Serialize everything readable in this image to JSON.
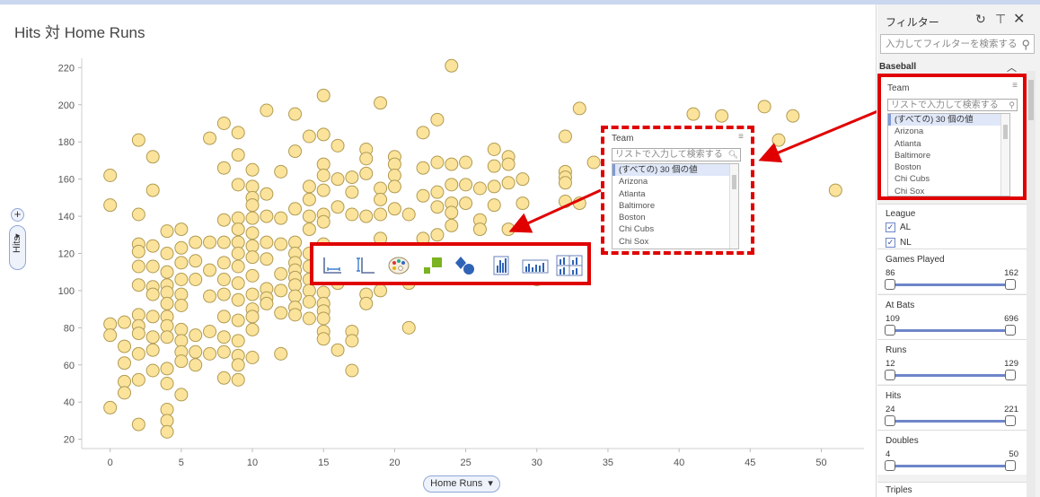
{
  "visualization": {
    "title": "Hits 対 Home Runs",
    "x_axis_button": "Home Runs",
    "y_axis_button": "Hits",
    "plus": "+"
  },
  "chart_data": {
    "type": "scatter",
    "title": "Hits 対 Home Runs",
    "xlabel": "Home Runs",
    "ylabel": "Hits",
    "xlim": [
      -2,
      53
    ],
    "ylim": [
      15,
      225
    ],
    "xticks": [
      "0",
      "5",
      "10",
      "15",
      "20",
      "25",
      "30",
      "35",
      "40",
      "45",
      "50"
    ],
    "yticks": [
      "20",
      "40",
      "60",
      "80",
      "100",
      "120",
      "140",
      "160",
      "180",
      "200",
      "220"
    ],
    "grid": false,
    "marker_color": "#fbe39b",
    "marker_edge": "#b19b52",
    "points": [
      [
        0,
        162
      ],
      [
        0,
        146
      ],
      [
        0,
        82
      ],
      [
        0,
        76
      ],
      [
        0,
        37
      ],
      [
        1,
        83
      ],
      [
        1,
        70
      ],
      [
        1,
        61
      ],
      [
        1,
        51
      ],
      [
        1,
        45
      ],
      [
        2,
        181
      ],
      [
        2,
        141
      ],
      [
        2,
        125
      ],
      [
        2,
        121
      ],
      [
        2,
        113
      ],
      [
        2,
        103
      ],
      [
        2,
        87
      ],
      [
        2,
        81
      ],
      [
        2,
        77
      ],
      [
        2,
        66
      ],
      [
        2,
        52
      ],
      [
        2,
        28
      ],
      [
        3,
        172
      ],
      [
        3,
        154
      ],
      [
        3,
        124
      ],
      [
        3,
        113
      ],
      [
        3,
        102
      ],
      [
        3,
        98
      ],
      [
        3,
        86
      ],
      [
        3,
        75
      ],
      [
        3,
        68
      ],
      [
        3,
        57
      ],
      [
        4,
        132
      ],
      [
        4,
        120
      ],
      [
        4,
        110
      ],
      [
        4,
        103
      ],
      [
        4,
        99
      ],
      [
        4,
        93
      ],
      [
        4,
        86
      ],
      [
        4,
        81
      ],
      [
        4,
        75
      ],
      [
        4,
        58
      ],
      [
        4,
        50
      ],
      [
        4,
        36
      ],
      [
        4,
        30
      ],
      [
        4,
        24
      ],
      [
        5,
        133
      ],
      [
        5,
        123
      ],
      [
        5,
        115
      ],
      [
        5,
        106
      ],
      [
        5,
        98
      ],
      [
        5,
        92
      ],
      [
        5,
        79
      ],
      [
        5,
        73
      ],
      [
        5,
        67
      ],
      [
        5,
        62
      ],
      [
        5,
        44
      ],
      [
        6,
        126
      ],
      [
        6,
        116
      ],
      [
        6,
        106
      ],
      [
        6,
        76
      ],
      [
        6,
        67
      ],
      [
        6,
        60
      ],
      [
        7,
        182
      ],
      [
        7,
        126
      ],
      [
        7,
        111
      ],
      [
        7,
        97
      ],
      [
        7,
        78
      ],
      [
        7,
        66
      ],
      [
        8,
        190
      ],
      [
        8,
        166
      ],
      [
        8,
        138
      ],
      [
        8,
        126
      ],
      [
        8,
        115
      ],
      [
        8,
        106
      ],
      [
        8,
        98
      ],
      [
        8,
        86
      ],
      [
        8,
        75
      ],
      [
        8,
        67
      ],
      [
        8,
        53
      ],
      [
        9,
        185
      ],
      [
        9,
        173
      ],
      [
        9,
        157
      ],
      [
        9,
        139
      ],
      [
        9,
        133
      ],
      [
        9,
        126
      ],
      [
        9,
        120
      ],
      [
        9,
        113
      ],
      [
        9,
        104
      ],
      [
        9,
        95
      ],
      [
        9,
        84
      ],
      [
        9,
        73
      ],
      [
        9,
        65
      ],
      [
        9,
        60
      ],
      [
        9,
        52
      ],
      [
        10,
        165
      ],
      [
        10,
        156
      ],
      [
        10,
        150
      ],
      [
        10,
        146
      ],
      [
        10,
        139
      ],
      [
        10,
        131
      ],
      [
        10,
        124
      ],
      [
        10,
        118
      ],
      [
        10,
        108
      ],
      [
        10,
        98
      ],
      [
        10,
        90
      ],
      [
        10,
        86
      ],
      [
        10,
        79
      ],
      [
        10,
        64
      ],
      [
        11,
        197
      ],
      [
        11,
        152
      ],
      [
        11,
        140
      ],
      [
        11,
        126
      ],
      [
        11,
        117
      ],
      [
        11,
        101
      ],
      [
        11,
        96
      ],
      [
        11,
        93
      ],
      [
        12,
        164
      ],
      [
        12,
        139
      ],
      [
        12,
        125
      ],
      [
        12,
        109
      ],
      [
        12,
        100
      ],
      [
        12,
        88
      ],
      [
        12,
        66
      ],
      [
        13,
        195
      ],
      [
        13,
        175
      ],
      [
        13,
        144
      ],
      [
        13,
        126
      ],
      [
        13,
        120
      ],
      [
        13,
        115
      ],
      [
        13,
        111
      ],
      [
        13,
        107
      ],
      [
        13,
        103
      ],
      [
        13,
        97
      ],
      [
        13,
        91
      ],
      [
        13,
        87
      ],
      [
        14,
        183
      ],
      [
        14,
        156
      ],
      [
        14,
        149
      ],
      [
        14,
        140
      ],
      [
        14,
        133
      ],
      [
        14,
        120
      ],
      [
        14,
        113
      ],
      [
        14,
        106
      ],
      [
        14,
        100
      ],
      [
        14,
        94
      ],
      [
        14,
        85
      ],
      [
        15,
        205
      ],
      [
        15,
        184
      ],
      [
        15,
        168
      ],
      [
        15,
        162
      ],
      [
        15,
        154
      ],
      [
        15,
        141
      ],
      [
        15,
        137
      ],
      [
        15,
        125
      ],
      [
        15,
        115
      ],
      [
        15,
        108
      ],
      [
        15,
        99
      ],
      [
        15,
        93
      ],
      [
        15,
        89
      ],
      [
        15,
        85
      ],
      [
        15,
        78
      ],
      [
        15,
        74
      ],
      [
        16,
        178
      ],
      [
        16,
        160
      ],
      [
        16,
        145
      ],
      [
        16,
        120
      ],
      [
        16,
        104
      ],
      [
        16,
        68
      ],
      [
        17,
        161
      ],
      [
        17,
        153
      ],
      [
        17,
        141
      ],
      [
        17,
        78
      ],
      [
        17,
        73
      ],
      [
        17,
        57
      ],
      [
        18,
        176
      ],
      [
        18,
        171
      ],
      [
        18,
        163
      ],
      [
        18,
        140
      ],
      [
        18,
        110
      ],
      [
        18,
        98
      ],
      [
        18,
        93
      ],
      [
        19,
        201
      ],
      [
        19,
        155
      ],
      [
        19,
        149
      ],
      [
        19,
        141
      ],
      [
        19,
        128
      ],
      [
        19,
        120
      ],
      [
        19,
        100
      ],
      [
        20,
        172
      ],
      [
        20,
        168
      ],
      [
        20,
        162
      ],
      [
        20,
        156
      ],
      [
        20,
        144
      ],
      [
        20,
        122
      ],
      [
        20,
        115
      ],
      [
        20,
        109
      ],
      [
        21,
        141
      ],
      [
        21,
        106
      ],
      [
        21,
        104
      ],
      [
        21,
        80
      ],
      [
        22,
        185
      ],
      [
        22,
        166
      ],
      [
        22,
        151
      ],
      [
        22,
        128
      ],
      [
        23,
        192
      ],
      [
        23,
        169
      ],
      [
        23,
        153
      ],
      [
        23,
        145
      ],
      [
        23,
        130
      ],
      [
        24,
        221
      ],
      [
        24,
        168
      ],
      [
        24,
        157
      ],
      [
        24,
        147
      ],
      [
        24,
        142
      ],
      [
        24,
        135
      ],
      [
        25,
        169
      ],
      [
        25,
        157
      ],
      [
        25,
        147
      ],
      [
        26,
        155
      ],
      [
        26,
        138
      ],
      [
        26,
        133
      ],
      [
        27,
        176
      ],
      [
        27,
        167
      ],
      [
        27,
        156
      ],
      [
        27,
        146
      ],
      [
        28,
        172
      ],
      [
        28,
        168
      ],
      [
        28,
        158
      ],
      [
        28,
        133
      ],
      [
        29,
        160
      ],
      [
        29,
        147
      ],
      [
        29,
        122
      ],
      [
        30,
        106
      ],
      [
        32,
        183
      ],
      [
        32,
        164
      ],
      [
        32,
        161
      ],
      [
        32,
        158
      ],
      [
        32,
        148
      ],
      [
        33,
        198
      ],
      [
        33,
        147
      ],
      [
        34,
        169
      ],
      [
        41,
        195
      ],
      [
        41,
        156
      ],
      [
        43,
        194
      ],
      [
        43,
        162
      ],
      [
        46,
        199
      ],
      [
        47,
        181
      ],
      [
        48,
        194
      ],
      [
        51,
        154
      ]
    ]
  },
  "toolbar_callout": {
    "icons": [
      "x-axis-scale-icon",
      "y-axis-scale-icon",
      "color-palette-icon",
      "marker-size-icon",
      "marker-shape-icon",
      "trellis-column-icon",
      "trellis-row-icon",
      "trellis-grid-icon"
    ]
  },
  "team_callout": {
    "title": "Team",
    "menu": "≡",
    "search_placeholder": "リストで入力して検索する",
    "items": [
      "(すべての) 30 個の値",
      "Arizona",
      "Atlanta",
      "Baltimore",
      "Boston",
      "Chi Cubs",
      "Chi Sox"
    ]
  },
  "filter_panel": {
    "title": "フィルター",
    "reset_icon": "↻",
    "pin_icon": "⊤",
    "close_icon": "✕",
    "search_placeholder": "入力してフィルターを検索する",
    "section": "Baseball",
    "section_chevron": "︿",
    "team": {
      "title": "Team",
      "menu": "≡",
      "search_placeholder": "リストで入力して検索する",
      "items": [
        "(すべての) 30 個の値",
        "Arizona",
        "Atlanta",
        "Baltimore",
        "Boston",
        "Chi Cubs",
        "Chi Sox"
      ]
    },
    "league": {
      "title": "League",
      "options": [
        {
          "label": "AL",
          "checked": true
        },
        {
          "label": "NL",
          "checked": true
        }
      ]
    },
    "ranges": [
      {
        "title": "Games Played",
        "min": "86",
        "max": "162"
      },
      {
        "title": "At Bats",
        "min": "109",
        "max": "696"
      },
      {
        "title": "Runs",
        "min": "12",
        "max": "129"
      },
      {
        "title": "Hits",
        "min": "24",
        "max": "221"
      },
      {
        "title": "Doubles",
        "min": "4",
        "max": "50"
      }
    ],
    "next_section": "Triples",
    "accent": "#6e86c9",
    "highlight": "#e00000"
  }
}
